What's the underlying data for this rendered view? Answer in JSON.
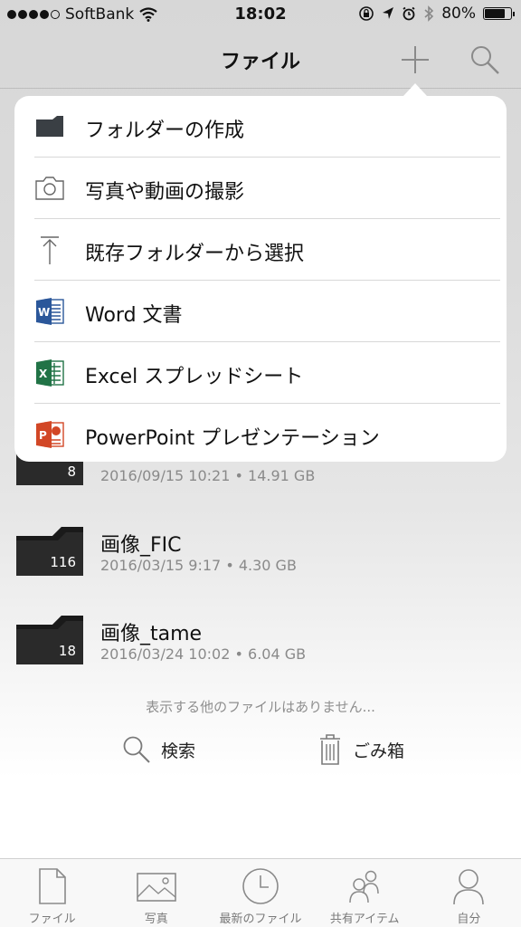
{
  "status_bar": {
    "carrier": "SoftBank",
    "time": "18:02",
    "battery": "80%",
    "battery_level": 0.8,
    "signal_bars": 4
  },
  "navbar": {
    "title": "ファイル",
    "add_icon": "plus-icon",
    "search_icon": "search-icon"
  },
  "popover_menu": {
    "items": [
      {
        "label": "フォルダーの作成",
        "icon": "folder-icon"
      },
      {
        "label": "写真や動画の撮影",
        "icon": "camera-icon"
      },
      {
        "label": "既存フォルダーから選択",
        "icon": "upload-arrow-icon"
      },
      {
        "label": "Word 文書",
        "icon": "word-icon"
      },
      {
        "label": "Excel スプレッドシート",
        "icon": "excel-icon"
      },
      {
        "label": "PowerPoint プレゼンテーション",
        "icon": "powerpoint-icon"
      }
    ]
  },
  "files": [
    {
      "name": "",
      "count": "8",
      "meta": "2016/09/15 10:21 • 14.91 GB"
    },
    {
      "name": "画像_FIC",
      "count": "116",
      "meta": "2016/03/15 9:17 • 4.30 GB"
    },
    {
      "name": "画像_tame",
      "count": "18",
      "meta": "2016/03/24 10:02 • 6.04 GB"
    }
  ],
  "list_footer": {
    "no_more_text": "表示する他のファイルはありません...",
    "search_label": "検索",
    "trash_label": "ごみ箱"
  },
  "tab_bar": {
    "tabs": [
      {
        "label": "ファイル",
        "icon": "file-icon"
      },
      {
        "label": "写真",
        "icon": "photo-icon"
      },
      {
        "label": "最新のファイル",
        "icon": "clock-icon"
      },
      {
        "label": "共有アイテム",
        "icon": "people-icon"
      },
      {
        "label": "自分",
        "icon": "person-icon"
      }
    ]
  },
  "colors": {
    "word": "#2b579a",
    "excel": "#217346",
    "powerpoint": "#d24726",
    "folder": "#2b2b2b"
  }
}
